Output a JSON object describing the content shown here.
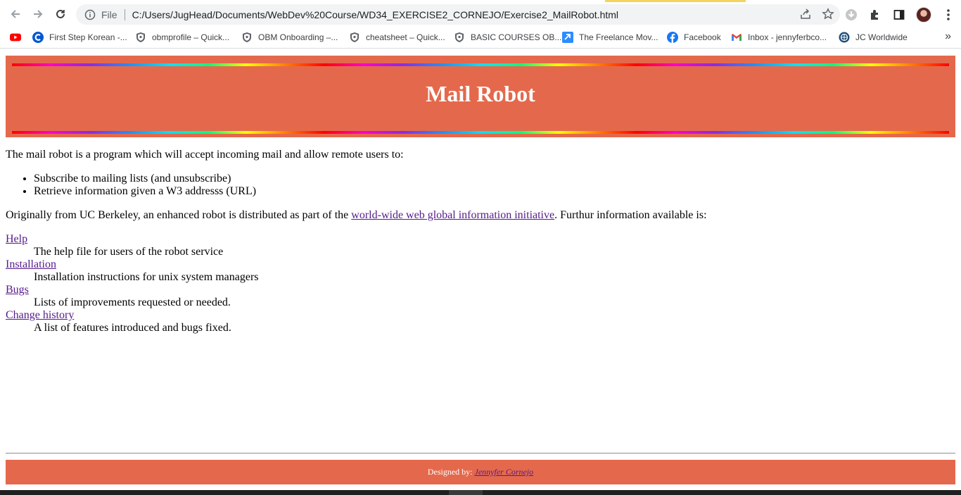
{
  "browser": {
    "scheme_label": "File",
    "url": "C:/Users/JugHead/Documents/WebDev%20Course/WD34_EXERCISE2_CORNEJO/Exercise2_MailRobot.html",
    "bookmarks": [
      {
        "label": "First Step Korean -...",
        "icon": "coursera-icon"
      },
      {
        "label": "obmprofile – Quick...",
        "icon": "shield-icon"
      },
      {
        "label": "OBM Onboarding –...",
        "icon": "shield-icon"
      },
      {
        "label": "cheatsheet – Quick...",
        "icon": "shield-icon"
      },
      {
        "label": "BASIC COURSES OB...",
        "icon": "shield-icon"
      },
      {
        "label": "The Freelance Mov...",
        "icon": "zoom-icon"
      },
      {
        "label": "Facebook",
        "icon": "facebook-icon"
      },
      {
        "label": "Inbox - jennyferbco...",
        "icon": "gmail-icon"
      },
      {
        "label": "JC Worldwide",
        "icon": "globe-icon"
      }
    ]
  },
  "page": {
    "title": "Mail Robot",
    "intro": "The mail robot is a program which will accept incoming mail and allow remote users to:",
    "features": [
      "Subscribe to mailing lists (and unsubscribe)",
      "Retrieve information given a W3 addresss (URL)"
    ],
    "origin_before": "Originally from UC Berkeley, an enhanced robot is distributed as part of the ",
    "origin_link": "world-wide web global information initiative",
    "origin_after": ". Furthur information available is:",
    "resources": [
      {
        "term": "Help",
        "desc": "The help file for users of the robot service"
      },
      {
        "term": "Installation",
        "desc": "Installation instructions for unix system managers"
      },
      {
        "term": "Bugs",
        "desc": "Lists of improvements requested or needed."
      },
      {
        "term": "Change history",
        "desc": "A list of features introduced and bugs fixed."
      }
    ],
    "footer_prefix": "Designed by: ",
    "footer_author": "Jennyfer Cornejo"
  },
  "colors": {
    "banner": "#e4694c",
    "link": "#551a8b"
  }
}
